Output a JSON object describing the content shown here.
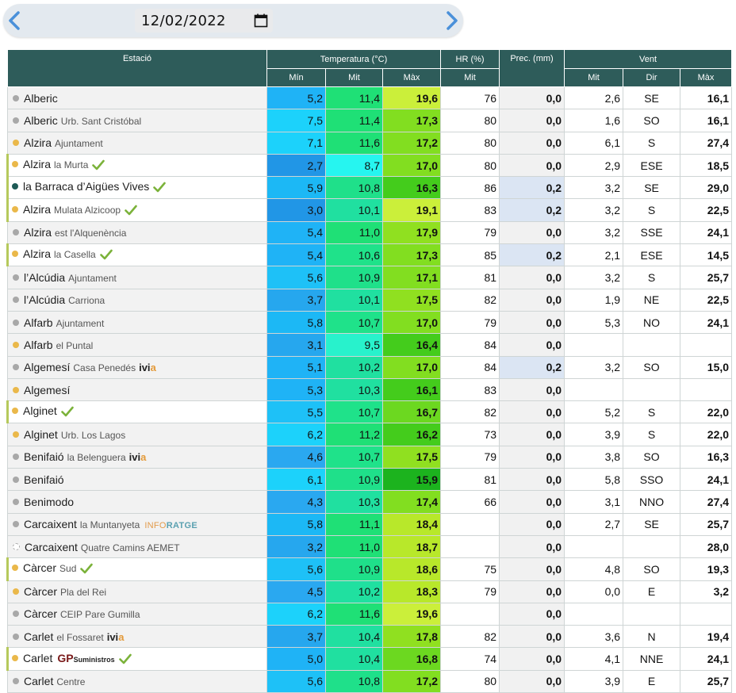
{
  "date": {
    "value": "12/02/2022"
  },
  "header": {
    "station": "Estació",
    "temperature": "Temperatura (°C)",
    "humidity": "HR (%)",
    "precipitation": "Prec. (mm)",
    "wind": "Vent",
    "t_min": "Mín",
    "t_mit": "Mit",
    "t_max": "Màx",
    "hr_mit": "Mit",
    "w_mit": "Mit",
    "w_dir": "Dir",
    "w_max": "Màx"
  },
  "colors": {
    "header_bg": "#2e5c5a",
    "dot_grey": "#a8a8a8",
    "dot_yellow": "#eab84a",
    "dot_dark": "#1e5a56",
    "check_green": "#7bb23a"
  },
  "rows": [
    {
      "name": "Alberic",
      "loc": "",
      "dot": "grey",
      "check": false,
      "badge": "",
      "tmin": "5,2",
      "tmit": "11,4",
      "tmax": "19,6",
      "hr": "76",
      "prec": "0,0",
      "vmit": "2,6",
      "vdir": "SE",
      "vmax": "16,1"
    },
    {
      "name": "Alberic",
      "loc": "Urb. Sant Cristóbal",
      "dot": "grey",
      "check": false,
      "badge": "",
      "tmin": "7,5",
      "tmit": "11,4",
      "tmax": "17,3",
      "hr": "80",
      "prec": "0,0",
      "vmit": "1,6",
      "vdir": "SO",
      "vmax": "16,1"
    },
    {
      "name": "Alzira",
      "loc": "Ajuntament",
      "dot": "yellow",
      "check": false,
      "badge": "",
      "tmin": "7,1",
      "tmit": "11,6",
      "tmax": "17,2",
      "hr": "80",
      "prec": "0,0",
      "vmit": "6,1",
      "vdir": "S",
      "vmax": "27,4"
    },
    {
      "name": "Alzira",
      "loc": "la Murta",
      "dot": "yellow",
      "check": true,
      "badge": "",
      "tmin": "2,7",
      "tmit": "8,7",
      "tmax": "17,0",
      "hr": "80",
      "prec": "0,0",
      "vmit": "2,9",
      "vdir": "ESE",
      "vmax": "18,5"
    },
    {
      "name": "la Barraca d’Aigües Vives",
      "loc": "",
      "dot": "dark",
      "check": true,
      "badge": "",
      "tmin": "5,9",
      "tmit": "10,8",
      "tmax": "16,3",
      "hr": "86",
      "prec": "0,2",
      "vmit": "3,2",
      "vdir": "SE",
      "vmax": "29,0"
    },
    {
      "name": "Alzira",
      "loc": "Mulata Alzicoop",
      "dot": "yellow",
      "check": true,
      "badge": "",
      "tmin": "3,0",
      "tmit": "10,1",
      "tmax": "19,1",
      "hr": "83",
      "prec": "0,2",
      "vmit": "3,2",
      "vdir": "S",
      "vmax": "22,5"
    },
    {
      "name": "Alzira",
      "loc": "est l'Alquenència",
      "dot": "grey",
      "check": false,
      "badge": "",
      "tmin": "5,4",
      "tmit": "11,0",
      "tmax": "17,9",
      "hr": "79",
      "prec": "0,0",
      "vmit": "3,2",
      "vdir": "SSE",
      "vmax": "24,1"
    },
    {
      "name": "Alzira",
      "loc": "la Casella",
      "dot": "yellow",
      "check": true,
      "badge": "",
      "tmin": "5,4",
      "tmit": "10,6",
      "tmax": "17,3",
      "hr": "85",
      "prec": "0,2",
      "vmit": "2,1",
      "vdir": "ESE",
      "vmax": "14,5"
    },
    {
      "name": "l’Alcúdia",
      "loc": "Ajuntament",
      "dot": "grey",
      "check": false,
      "badge": "",
      "tmin": "5,6",
      "tmit": "10,9",
      "tmax": "17,1",
      "hr": "81",
      "prec": "0,0",
      "vmit": "3,2",
      "vdir": "S",
      "vmax": "25,7"
    },
    {
      "name": "l’Alcúdia",
      "loc": "Carriona",
      "dot": "grey",
      "check": false,
      "badge": "",
      "tmin": "3,7",
      "tmit": "10,1",
      "tmax": "17,5",
      "hr": "82",
      "prec": "0,0",
      "vmit": "1,9",
      "vdir": "NE",
      "vmax": "22,5"
    },
    {
      "name": "Alfarb",
      "loc": "Ajuntament",
      "dot": "grey",
      "check": false,
      "badge": "",
      "tmin": "5,8",
      "tmit": "10,7",
      "tmax": "17,0",
      "hr": "79",
      "prec": "0,0",
      "vmit": "5,3",
      "vdir": "NO",
      "vmax": "24,1"
    },
    {
      "name": "Alfarb",
      "loc": "el Puntal",
      "dot": "yellow",
      "check": false,
      "badge": "",
      "tmin": "3,1",
      "tmit": "9,5",
      "tmax": "16,4",
      "hr": "84",
      "prec": "0,0",
      "vmit": "",
      "vdir": "",
      "vmax": ""
    },
    {
      "name": "Algemesí",
      "loc": "Casa Penedés",
      "dot": "grey",
      "check": false,
      "badge": "ivia",
      "tmin": "5,1",
      "tmit": "10,2",
      "tmax": "17,0",
      "hr": "84",
      "prec": "0,2",
      "vmit": "3,2",
      "vdir": "SO",
      "vmax": "15,0"
    },
    {
      "name": "Algemesí",
      "loc": "",
      "dot": "yellow",
      "check": false,
      "badge": "",
      "tmin": "5,3",
      "tmit": "10,3",
      "tmax": "16,1",
      "hr": "83",
      "prec": "0,0",
      "vmit": "",
      "vdir": "",
      "vmax": ""
    },
    {
      "name": "Alginet",
      "loc": "",
      "dot": "yellow",
      "check": true,
      "badge": "",
      "tmin": "5,5",
      "tmit": "10,7",
      "tmax": "16,7",
      "hr": "82",
      "prec": "0,0",
      "vmit": "5,2",
      "vdir": "S",
      "vmax": "22,0"
    },
    {
      "name": "Alginet",
      "loc": "Urb. Los Lagos",
      "dot": "yellow",
      "check": false,
      "badge": "",
      "tmin": "6,2",
      "tmit": "11,2",
      "tmax": "16,2",
      "hr": "73",
      "prec": "0,0",
      "vmit": "3,9",
      "vdir": "S",
      "vmax": "22,0"
    },
    {
      "name": "Benifaió",
      "loc": "la Belenguera",
      "dot": "grey",
      "check": false,
      "badge": "ivia",
      "tmin": "4,6",
      "tmit": "10,7",
      "tmax": "17,5",
      "hr": "79",
      "prec": "0,0",
      "vmit": "3,8",
      "vdir": "SO",
      "vmax": "16,3"
    },
    {
      "name": "Benifaió",
      "loc": "",
      "dot": "grey",
      "check": false,
      "badge": "",
      "tmin": "6,1",
      "tmit": "10,9",
      "tmax": "15,9",
      "hr": "81",
      "prec": "0,0",
      "vmit": "5,8",
      "vdir": "SSO",
      "vmax": "24,1"
    },
    {
      "name": "Benimodo",
      "loc": "",
      "dot": "grey",
      "check": false,
      "badge": "",
      "tmin": "4,3",
      "tmit": "10,3",
      "tmax": "17,4",
      "hr": "66",
      "prec": "0,0",
      "vmit": "3,1",
      "vdir": "NNO",
      "vmax": "27,4"
    },
    {
      "name": "Carcaixent",
      "loc": "la Muntanyeta",
      "dot": "grey",
      "check": false,
      "badge": "inforatge",
      "tmin": "5,8",
      "tmit": "11,1",
      "tmax": "18,4",
      "hr": "",
      "prec": "0,0",
      "vmit": "2,7",
      "vdir": "SE",
      "vmax": "25,7"
    },
    {
      "name": "Carcaixent",
      "loc": "Quatre Camins AEMET",
      "dot": "empty",
      "check": false,
      "badge": "",
      "tmin": "3,2",
      "tmit": "11,0",
      "tmax": "18,7",
      "hr": "",
      "prec": "0,0",
      "vmit": "",
      "vdir": "",
      "vmax": "28,0"
    },
    {
      "name": "Càrcer",
      "loc": "Sud",
      "dot": "yellow",
      "check": true,
      "badge": "",
      "tmin": "5,6",
      "tmit": "10,9",
      "tmax": "18,6",
      "hr": "75",
      "prec": "0,0",
      "vmit": "4,8",
      "vdir": "SO",
      "vmax": "19,3"
    },
    {
      "name": "Càrcer",
      "loc": "Pla del Rei",
      "dot": "yellow",
      "check": false,
      "badge": "",
      "tmin": "4,5",
      "tmit": "10,2",
      "tmax": "18,3",
      "hr": "79",
      "prec": "0,0",
      "vmit": "0,0",
      "vdir": "E",
      "vmax": "3,2"
    },
    {
      "name": "Càrcer",
      "loc": "CEIP Pare Gumilla",
      "dot": "grey",
      "check": false,
      "badge": "",
      "tmin": "6,2",
      "tmit": "11,6",
      "tmax": "19,6",
      "hr": "",
      "prec": "0,0",
      "vmit": "",
      "vdir": "",
      "vmax": ""
    },
    {
      "name": "Carlet",
      "loc": "el Fossaret",
      "dot": "grey",
      "check": false,
      "badge": "ivia",
      "tmin": "3,7",
      "tmit": "10,4",
      "tmax": "17,8",
      "hr": "82",
      "prec": "0,0",
      "vmit": "3,6",
      "vdir": "N",
      "vmax": "19,4"
    },
    {
      "name": "Carlet",
      "loc": "",
      "dot": "yellow",
      "check": true,
      "badge": "gp",
      "tmin": "5,0",
      "tmit": "10,4",
      "tmax": "16,8",
      "hr": "74",
      "prec": "0,0",
      "vmit": "4,1",
      "vdir": "NNE",
      "vmax": "24,1"
    },
    {
      "name": "Carlet",
      "loc": "Centre",
      "dot": "grey",
      "check": false,
      "badge": "",
      "tmin": "5,6",
      "tmit": "10,8",
      "tmax": "17,2",
      "hr": "80",
      "prec": "0,0",
      "vmit": "3,9",
      "vdir": "E",
      "vmax": "25,7"
    }
  ],
  "badges": {
    "ivia_main": "ivi",
    "ivia_tail": "a",
    "info_a": "INFO",
    "info_b": "RATGE",
    "gp_main": "GP",
    "gp_sub": "Suministros"
  }
}
